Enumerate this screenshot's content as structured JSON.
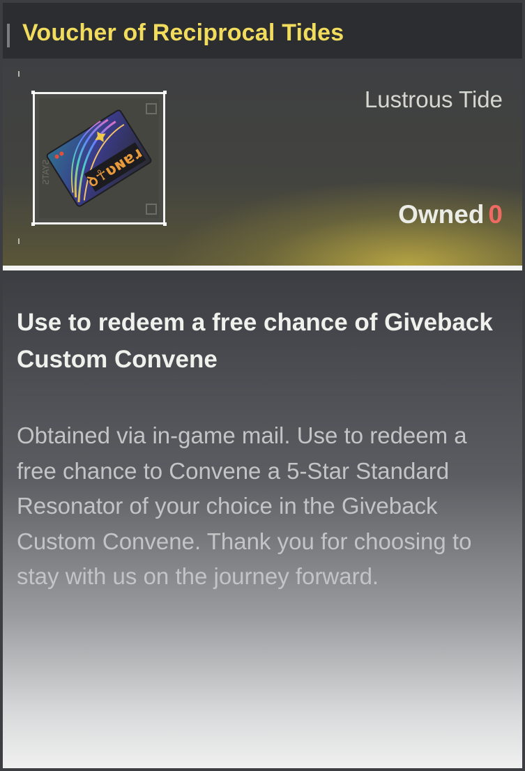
{
  "item": {
    "name": "Voucher of Reciprocal Tides",
    "category": "Lustrous Tide",
    "owned_label": "Owned",
    "owned_count": "0",
    "icon": "voucher-card-icon",
    "summary": "Use to redeem a free chance of Giveback Custom Convene",
    "description": "Obtained via in-game mail. Use to redeem a free chance to Convene a 5-Star Standard Resonator of your choice in the Giveback Custom Convene. Thank you for choosing to stay with us on the journey forward."
  },
  "colors": {
    "title": "#f2dc5d",
    "owned_count": "#ee6a62",
    "header_glow": "#d4be46"
  }
}
